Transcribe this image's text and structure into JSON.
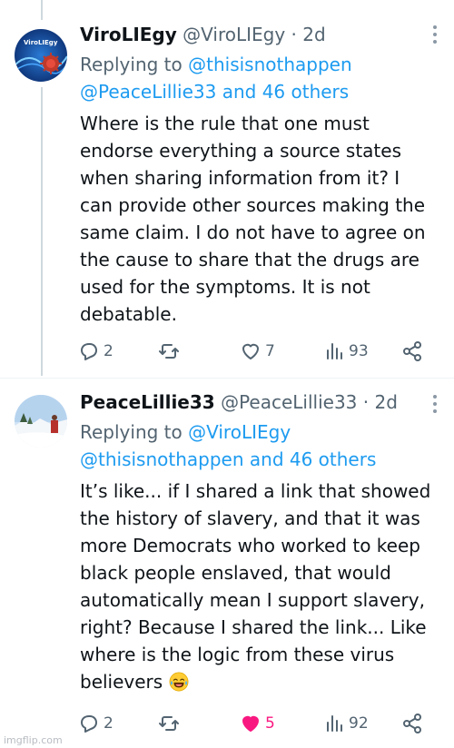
{
  "tweets": [
    {
      "name": "ViroLIEgy",
      "handle": "@ViroLIEgy",
      "dot": "·",
      "time": "2d",
      "replying_prefix": "Replying to",
      "replying_line1": "@thisisnothappen",
      "replying_line2_mention": "@PeaceLillie33",
      "replying_line2_rest": "and 46 others",
      "body_lines": [
        "Where is the rule that one must",
        "endorse everything a source states",
        "when sharing information from it? I",
        "can provide other sources making the",
        "same claim. I do not have to agree on",
        "the cause to share that the drugs are",
        "used for the symptoms. It is not",
        "debatable."
      ],
      "replies": "2",
      "retweets": "",
      "likes": "7",
      "views": "93",
      "liked": false,
      "avatar_icon": "virus-logo-avatar",
      "avatar_text": "ViroLIEgy"
    },
    {
      "name": "PeaceLillie33",
      "handle": "@PeaceLillie33",
      "dot": "·",
      "time": "2d",
      "replying_prefix": "Replying to",
      "replying_line1": "@ViroLIEgy",
      "replying_line2_mention": "@thisisnothappen",
      "replying_line2_rest": "and 46 others",
      "body_lines": [
        "It’s like... if I shared a link that showed",
        "the history of slavery, and that it was",
        "more Democrats who worked to keep",
        "black people enslaved, that would",
        "automatically mean I support slavery,",
        "right? Because I shared the link... Like",
        "where is the logic from these virus",
        "believers"
      ],
      "emoji": "😂",
      "replies": "2",
      "retweets": "",
      "likes": "5",
      "views": "92",
      "liked": true,
      "avatar_icon": "snowy-landscape-avatar"
    }
  ],
  "colors": {
    "text": "#0f1419",
    "secondary": "#536471",
    "link": "#1d9bf0",
    "like": "#f91880"
  },
  "watermark": "imgflip.com"
}
